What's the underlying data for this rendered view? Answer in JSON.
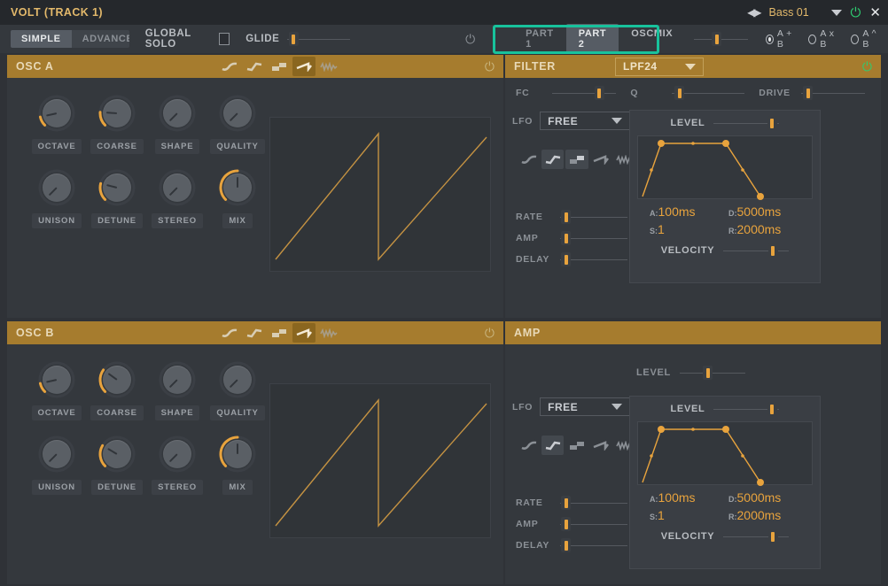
{
  "titlebar": {
    "app_title": "VOLT (TRACK 1)",
    "preset_prev_next": "◀▶",
    "preset_name": "Bass 01",
    "dropdown_icon": "caret-down-icon",
    "power_icon": "⏻",
    "close_icon": "✕"
  },
  "toolbar": {
    "mode_tabs": [
      {
        "label": "SIMPLE",
        "active": true
      },
      {
        "label": "ADVANCED",
        "active": false
      }
    ],
    "global_solo_label": "GLOBAL SOLO",
    "global_solo_checked": false,
    "glide_label": "GLIDE",
    "glide_value_pct": 2,
    "power_icon": "⏻",
    "part_tabs": [
      {
        "label": "PART 1",
        "active": false
      },
      {
        "label": "PART 2",
        "active": true
      },
      {
        "label": "OSCMIX",
        "active": false
      }
    ],
    "oscmix_value_pct": 40,
    "mix_modes": [
      {
        "label": "A + B",
        "selected": true
      },
      {
        "label": "A x B",
        "selected": false
      },
      {
        "label": "A ^ B",
        "selected": false
      }
    ]
  },
  "osc_a": {
    "title": "OSC A",
    "power_icon": "⏻",
    "waveforms": [
      {
        "name": "sine-wave-icon",
        "state": "off"
      },
      {
        "name": "triangle-wave-icon",
        "state": "off"
      },
      {
        "name": "square-wave-icon",
        "state": "off"
      },
      {
        "name": "saw-wave-icon",
        "state": "selected"
      },
      {
        "name": "noise-wave-icon",
        "state": "off"
      }
    ],
    "knobs": [
      {
        "label": "OCTAVE",
        "value_pct": 12
      },
      {
        "label": "COARSE",
        "value_pct": 18
      },
      {
        "label": "SHAPE",
        "value_pct": 0
      },
      {
        "label": "QUALITY",
        "value_pct": 0
      },
      {
        "label": "UNISON",
        "value_pct": 0
      },
      {
        "label": "DETUNE",
        "value_pct": 22
      },
      {
        "label": "STEREO",
        "value_pct": 0
      },
      {
        "label": "MIX",
        "value_pct": 50
      }
    ],
    "scope": "sawtooth-waveform"
  },
  "osc_b": {
    "title": "OSC B",
    "power_icon": "⏻",
    "waveforms": [
      {
        "name": "sine-wave-icon",
        "state": "off"
      },
      {
        "name": "triangle-wave-icon",
        "state": "off"
      },
      {
        "name": "square-wave-icon",
        "state": "off"
      },
      {
        "name": "saw-wave-icon",
        "state": "selected"
      },
      {
        "name": "noise-wave-icon",
        "state": "off"
      }
    ],
    "knobs": [
      {
        "label": "OCTAVE",
        "value_pct": 12
      },
      {
        "label": "COARSE",
        "value_pct": 30
      },
      {
        "label": "SHAPE",
        "value_pct": 0
      },
      {
        "label": "QUALITY",
        "value_pct": 0
      },
      {
        "label": "UNISON",
        "value_pct": 0
      },
      {
        "label": "DETUNE",
        "value_pct": 28
      },
      {
        "label": "STEREO",
        "value_pct": 0
      },
      {
        "label": "MIX",
        "value_pct": 50
      }
    ],
    "scope": "sawtooth-waveform"
  },
  "filter": {
    "title": "FILTER",
    "type": "LPF24",
    "power_icon": "⏻",
    "power_on": true,
    "sliders": [
      {
        "label": "FC",
        "value_pct": 78
      },
      {
        "label": "Q",
        "value_pct": 4
      },
      {
        "label": "DRIVE",
        "value_pct": 4
      }
    ],
    "lfo": {
      "label": "LFO",
      "mode": "FREE",
      "waveforms": [
        {
          "name": "sine-wave-icon",
          "state": "off"
        },
        {
          "name": "triangle-wave-icon",
          "state": "selected"
        },
        {
          "name": "square-wave-icon",
          "state": "hover"
        },
        {
          "name": "saw-wave-icon",
          "state": "off"
        },
        {
          "name": "noise-wave-icon",
          "state": "off"
        }
      ],
      "sliders": [
        {
          "label": "RATE",
          "value_pct": 2
        },
        {
          "label": "AMP",
          "value_pct": 2
        },
        {
          "label": "DELAY",
          "value_pct": 2
        }
      ]
    },
    "envelope": {
      "level_label": "LEVEL",
      "level_pct": 96,
      "velocity_label": "VELOCITY",
      "velocity_pct": 80,
      "attack_key": "A:",
      "attack_value": "100ms",
      "decay_key": "D:",
      "decay_value": "5000ms",
      "sustain_key": "S:",
      "sustain_value": "1",
      "release_key": "R:",
      "release_value": "2000ms"
    }
  },
  "amp": {
    "title": "AMP",
    "level_label": "LEVEL",
    "level_pct": 42,
    "lfo": {
      "label": "LFO",
      "mode": "FREE",
      "waveforms": [
        {
          "name": "sine-wave-icon",
          "state": "off"
        },
        {
          "name": "triangle-wave-icon",
          "state": "selected"
        },
        {
          "name": "square-wave-icon",
          "state": "off"
        },
        {
          "name": "saw-wave-icon",
          "state": "off"
        },
        {
          "name": "noise-wave-icon",
          "state": "off"
        }
      ],
      "sliders": [
        {
          "label": "RATE",
          "value_pct": 2
        },
        {
          "label": "AMP",
          "value_pct": 2
        },
        {
          "label": "DELAY",
          "value_pct": 2
        }
      ]
    },
    "envelope": {
      "level_label": "LEVEL",
      "level_pct": 96,
      "velocity_label": "VELOCITY",
      "velocity_pct": 80,
      "attack_key": "A:",
      "attack_value": "100ms",
      "decay_key": "D:",
      "decay_value": "5000ms",
      "sustain_key": "S:",
      "sustain_value": "1",
      "release_key": "R:",
      "release_value": "2000ms"
    }
  },
  "colors": {
    "accent_orange": "#e8a33d",
    "header_gold": "#a67c2e",
    "annotation_teal": "#18c29c",
    "power_green": "#2ecc71",
    "panel_bg": "#34383d",
    "window_bg": "#2f3237"
  }
}
